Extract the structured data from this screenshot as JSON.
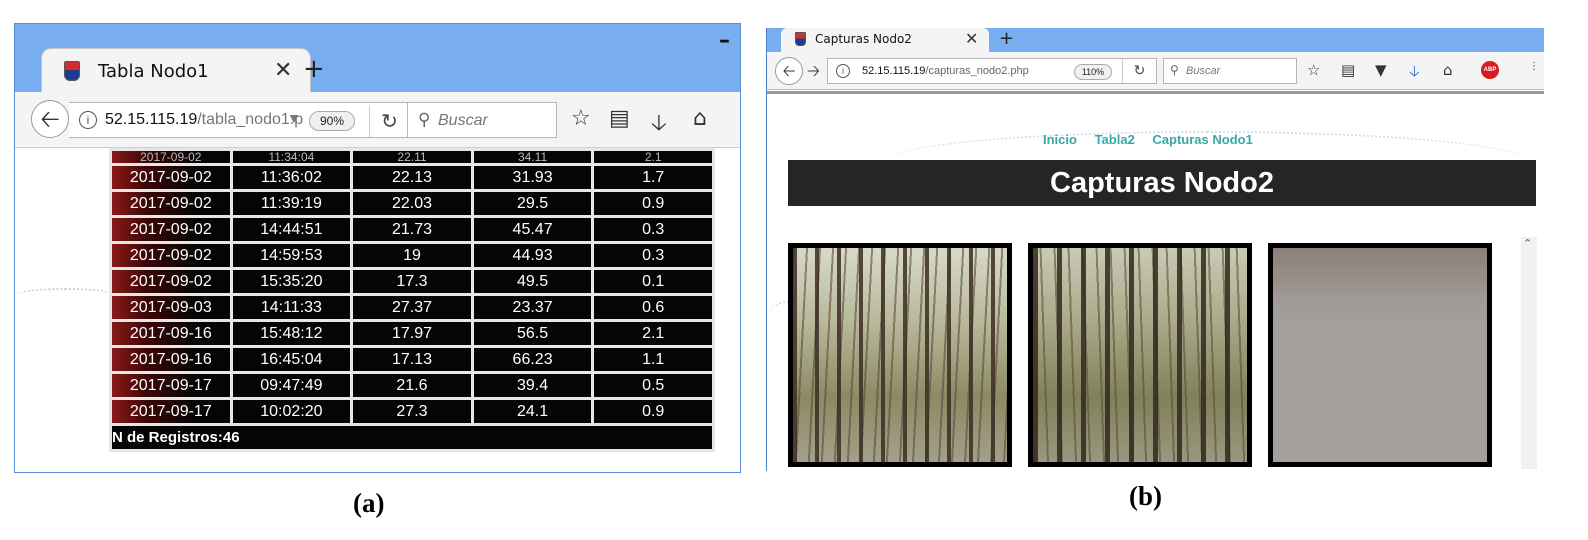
{
  "panel_a": {
    "tab_title": "Tabla Nodo1",
    "url_host": "52.15.115.19",
    "url_path": "/tabla_nodo1.p",
    "zoom": "90%",
    "search_placeholder": "Buscar",
    "partial_row": [
      "2017-09-02",
      "11:34:04",
      "22.11",
      "34.11",
      "2.1"
    ],
    "rows": [
      [
        "2017-09-02",
        "11:36:02",
        "22.13",
        "31.93",
        "1.7"
      ],
      [
        "2017-09-02",
        "11:39:19",
        "22.03",
        "29.5",
        "0.9"
      ],
      [
        "2017-09-02",
        "14:44:51",
        "21.73",
        "45.47",
        "0.3"
      ],
      [
        "2017-09-02",
        "14:59:53",
        "19",
        "44.93",
        "0.3"
      ],
      [
        "2017-09-02",
        "15:35:20",
        "17.3",
        "49.5",
        "0.1"
      ],
      [
        "2017-09-03",
        "14:11:33",
        "27.37",
        "23.37",
        "0.6"
      ],
      [
        "2017-09-16",
        "15:48:12",
        "17.97",
        "56.5",
        "2.1"
      ],
      [
        "2017-09-16",
        "16:45:04",
        "17.13",
        "66.23",
        "1.1"
      ],
      [
        "2017-09-17",
        "09:47:49",
        "21.6",
        "39.4",
        "0.5"
      ],
      [
        "2017-09-17",
        "10:02:20",
        "27.3",
        "24.1",
        "0.9"
      ]
    ],
    "footer": "N de Registros:46",
    "caption": "(a)"
  },
  "panel_b": {
    "tab_title": "Capturas Nodo2",
    "url_host": "52.15.115.19",
    "url_path": "/capturas_nodo2.php",
    "zoom": "110%",
    "search_placeholder": "Buscar",
    "abp_label": "ABP",
    "nav_links": [
      "Inicio",
      "Tabla2",
      "Capturas Nodo1"
    ],
    "page_title": "Capturas Nodo2",
    "caption": "(b)"
  },
  "colors": {
    "titlebar": "#78adf0",
    "table_cell": "#050505",
    "link": "#3aa7a7",
    "header_bg": "#252525"
  }
}
